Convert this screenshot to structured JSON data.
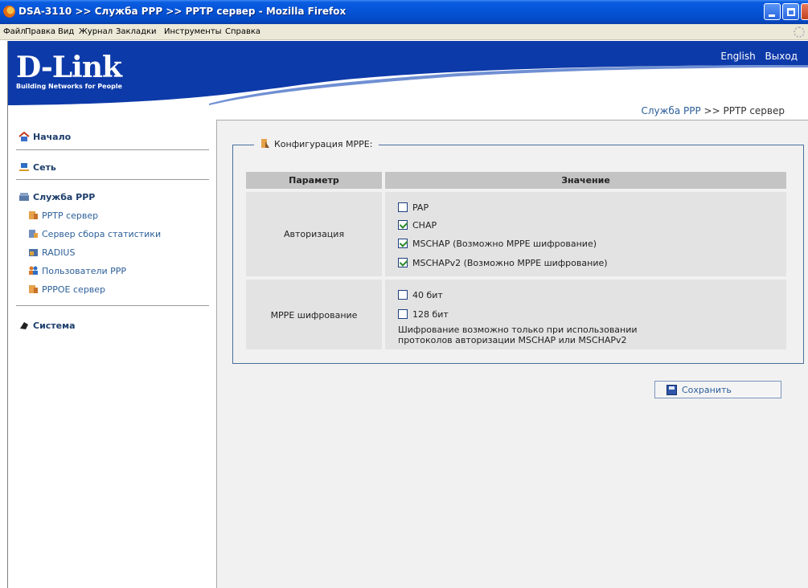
{
  "window": {
    "title": "DSA-3110 >> Служба PPP >> PPTP сервер - Mozilla Firefox"
  },
  "menu": [
    "Файл",
    "Правка",
    "Вид",
    "Журнал",
    "Закладки",
    "Инструменты",
    "Справка"
  ],
  "header": {
    "brand": "D-Link",
    "tagline": "Building Networks for People",
    "lang_link": "English",
    "logout_link": "Выход",
    "breadcrumb_link": "Служба PPP",
    "breadcrumb_sep": " >> ",
    "breadcrumb_current": "PPTP сервер"
  },
  "sidebar": {
    "home": "Начало",
    "network": "Сеть",
    "ppp": "Служба PPP",
    "ppp_items": [
      "PPTP сервер",
      "Сервер сбора статистики",
      "RADIUS",
      "Пользователи PPP",
      "PPPOE сервер"
    ],
    "system": "Система"
  },
  "form": {
    "legend": "Конфигурация MPPE:",
    "col_param": "Параметр",
    "col_value": "Значение",
    "auth_label": "Авторизация",
    "auth_options": [
      {
        "label": "PAP",
        "checked": false
      },
      {
        "label": "CHAP",
        "checked": true
      },
      {
        "label": "MSCHAP (Возможно MPPE шифрование)",
        "checked": true
      },
      {
        "label": "MSCHAPv2 (Возможно MPPE шифрование)",
        "checked": true
      }
    ],
    "mppe_label": "MPPE шифрование",
    "mppe_options": [
      {
        "label": "40 бит",
        "checked": false
      },
      {
        "label": "128 бит",
        "checked": false
      }
    ],
    "note_line1": "Шифрование возможно только при использовании",
    "note_line2": "протоколов авторизации MSCHAP или MSCHAPv2",
    "save_label": "Сохранить"
  },
  "colors": {
    "header_blue": "#0d3aa9",
    "link_blue": "#2c5f99",
    "title_bar": "#0553d6"
  }
}
